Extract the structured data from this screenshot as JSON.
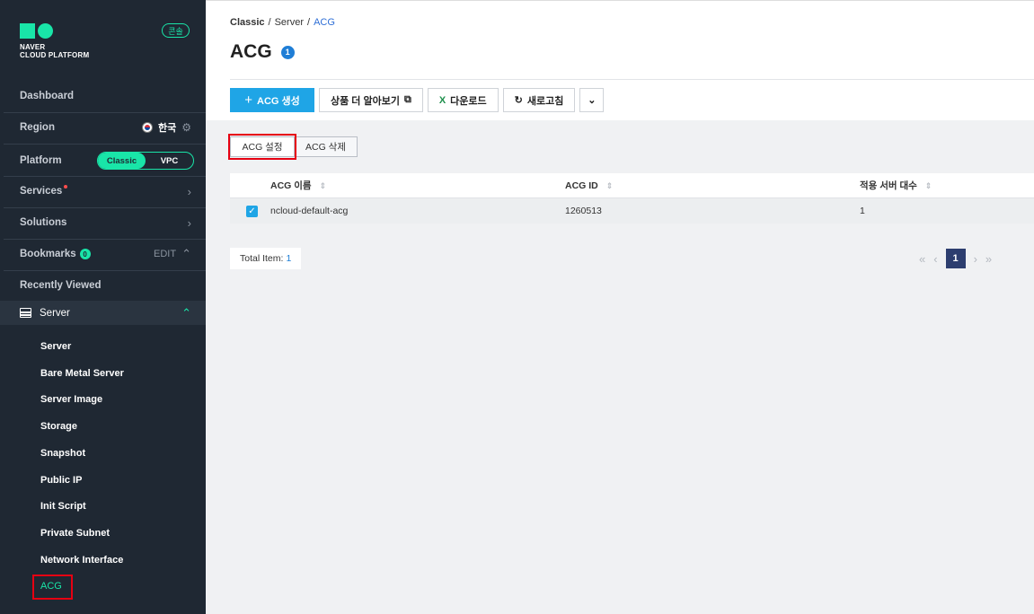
{
  "sidebar": {
    "logo_line1": "NAVER",
    "logo_line2": "CLOUD PLATFORM",
    "console_badge": "콘솔",
    "dashboard": "Dashboard",
    "region": {
      "label": "Region",
      "value": "한국"
    },
    "platform": {
      "label": "Platform",
      "options": [
        "Classic",
        "VPC"
      ],
      "selected": "Classic"
    },
    "services": "Services",
    "solutions": "Solutions",
    "bookmarks": {
      "label": "Bookmarks",
      "count": "0",
      "edit": "EDIT"
    },
    "recently_viewed": "Recently Viewed",
    "server_group": "Server",
    "server_items": [
      "Server",
      "Bare Metal Server",
      "Server Image",
      "Storage",
      "Snapshot",
      "Public IP",
      "Init Script",
      "Private Subnet",
      "Network Interface",
      "ACG"
    ],
    "active_item": "ACG"
  },
  "breadcrumb": [
    "Classic",
    "Server",
    "ACG"
  ],
  "page": {
    "title": "ACG",
    "count": "1"
  },
  "toolbar": {
    "create": "ACG 생성",
    "learn_more": "상품 더 알아보기",
    "download": "다운로드",
    "refresh": "새로고침"
  },
  "actions": {
    "settings": "ACG 설정",
    "delete": "ACG 삭제"
  },
  "table": {
    "columns": [
      "ACG 이름",
      "ACG ID",
      "적용 서버 대수"
    ],
    "rows": [
      {
        "name": "ncloud-default-acg",
        "id": "1260513",
        "servers": "1",
        "checked": true
      }
    ]
  },
  "footer": {
    "total_label": "Total Item:",
    "total_value": "1",
    "current_page": "1"
  },
  "colors": {
    "accent_green": "#19e5a8",
    "primary_blue": "#1fa5e6",
    "highlight_red": "#e60012",
    "sidebar_bg": "#1f2833"
  }
}
